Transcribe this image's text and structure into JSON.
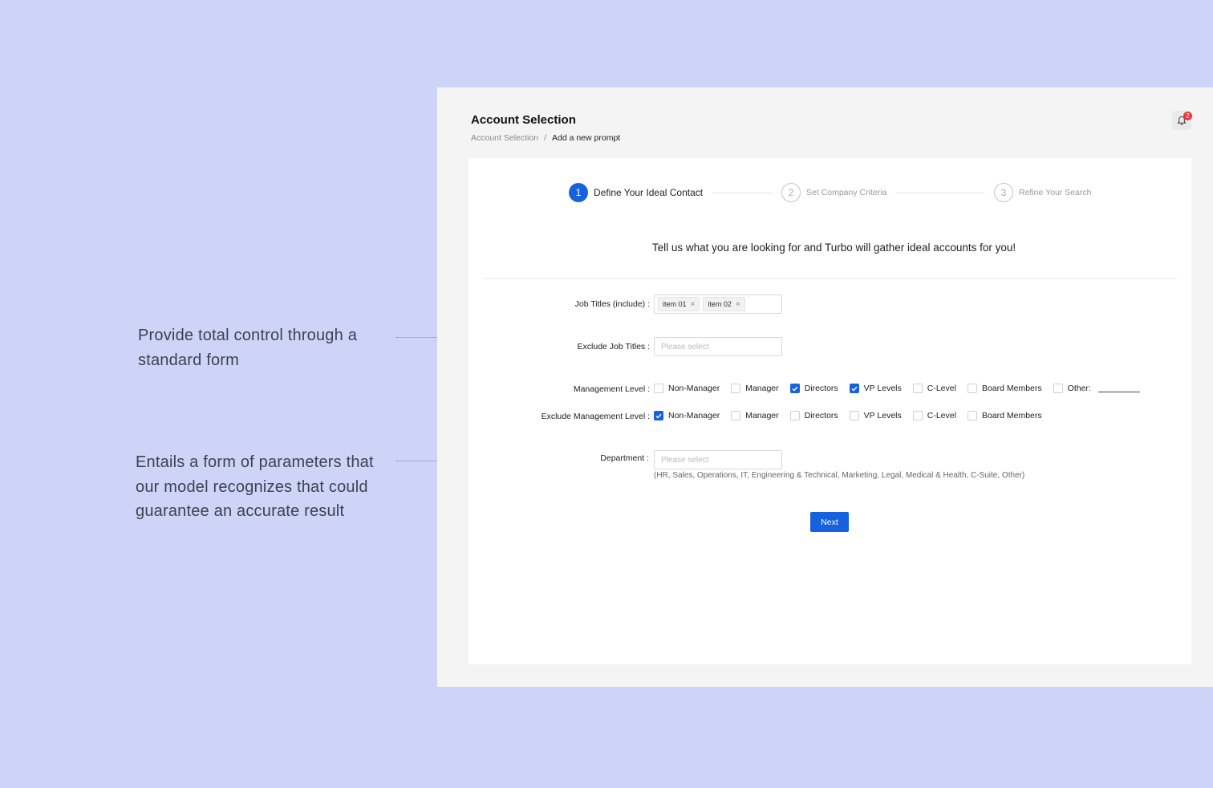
{
  "annotations": {
    "note1": "Provide total control through a standard form",
    "note2": "Entails a form of parameters that our model recognizes that could guarantee an accurate result"
  },
  "header": {
    "title": "Account Selection",
    "breadcrumb": {
      "parent": "Account Selection",
      "separator": "/",
      "current": "Add a new prompt"
    },
    "notifications": {
      "icon": "bell-icon",
      "count": "2"
    }
  },
  "stepper": {
    "steps": [
      {
        "number": "1",
        "label": "Define Your Ideal Contact",
        "state": "active"
      },
      {
        "number": "2",
        "label": "Set Company Criteria",
        "state": "pending"
      },
      {
        "number": "3",
        "label": "Refine Your Search",
        "state": "pending"
      }
    ]
  },
  "tagline": "Tell us what you are looking for and Turbo will gather ideal accounts for you!",
  "form": {
    "job_titles": {
      "label": "Job Titles (include) :",
      "tags": [
        "item 01",
        "item 02"
      ]
    },
    "exclude_job_titles": {
      "label": "Exclude Job Titles :",
      "placeholder": "Please select"
    },
    "management_level": {
      "label": "Management Level :",
      "options": [
        {
          "label": "Non-Manager",
          "checked": false
        },
        {
          "label": "Manager",
          "checked": false
        },
        {
          "label": "Directors",
          "checked": true
        },
        {
          "label": "VP Levels",
          "checked": true
        },
        {
          "label": "C-Level",
          "checked": false
        },
        {
          "label": "Board Members",
          "checked": false
        },
        {
          "label": "Other:",
          "checked": false
        }
      ]
    },
    "exclude_management_level": {
      "label": "Exclude Management Level :",
      "options": [
        {
          "label": "Non-Manager",
          "checked": true
        },
        {
          "label": "Manager",
          "checked": false
        },
        {
          "label": "Directors",
          "checked": false
        },
        {
          "label": "VP Levels",
          "checked": false
        },
        {
          "label": "C-Level",
          "checked": false
        },
        {
          "label": "Board Members",
          "checked": false
        }
      ]
    },
    "department": {
      "label": "Department :",
      "placeholder": "Please select",
      "hint": "(HR, Sales, Operations, IT, Engineering & Technical, Marketing, Legal, Medical & Health, C-Suite, Other)"
    },
    "next_label": "Next"
  },
  "colors": {
    "accent": "#1662dd",
    "badge": "#f0353b",
    "background": "#cdd4f7"
  }
}
